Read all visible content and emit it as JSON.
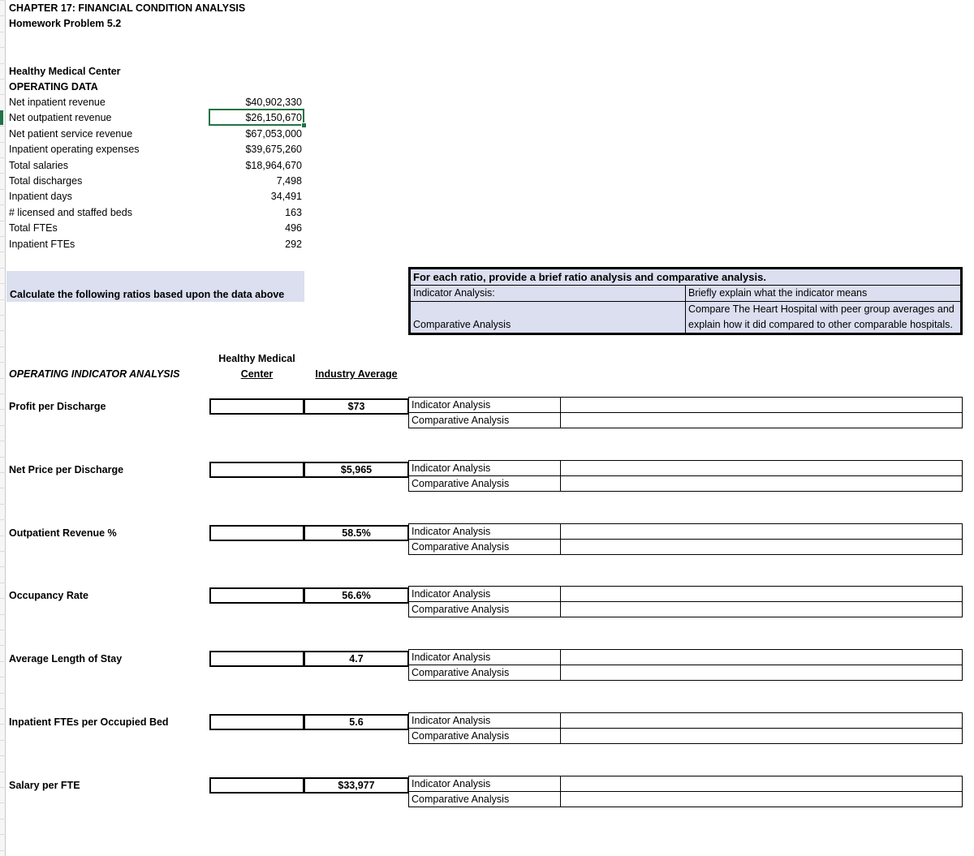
{
  "document": {
    "chapter_title": "CHAPTER 17: FINANCIAL CONDITION ANALYSIS",
    "homework_title": "Homework Problem 5.2",
    "entity_name": "Healthy  Medical Center",
    "section_title": "OPERATING DATA"
  },
  "operating_data": [
    {
      "label": "Net inpatient revenue",
      "value": "$40,902,330"
    },
    {
      "label": "Net outpatient revenue",
      "value": "$26,150,670"
    },
    {
      "label": "Net patient service revenue",
      "value": "$67,053,000"
    },
    {
      "label": "Inpatient operating expenses",
      "value": "$39,675,260"
    },
    {
      "label": "Total salaries",
      "value": "$18,964,670"
    },
    {
      "label": "Total discharges",
      "value": "7,498"
    },
    {
      "label": "Inpatient days",
      "value": "34,491"
    },
    {
      "label": "# licensed and staffed beds",
      "value": "163"
    },
    {
      "label": "Total FTEs",
      "value": "496"
    },
    {
      "label": "Inpatient FTEs",
      "value": "292"
    }
  ],
  "selection": {
    "selected_cell_value": "$26,150,670",
    "selected_row_label": "Net outpatient revenue",
    "accent_color": "#217346"
  },
  "calc_note": {
    "text": "Calculate the following ratios based upon the data above",
    "fill_color": "#dbdfef"
  },
  "instruction_table": {
    "header": "For each ratio, provide a brief ratio analysis and comparative analysis.",
    "rows": [
      {
        "key": "Indicator Analysis:",
        "value": "Briefly explain what the indicator means"
      },
      {
        "key": "Comparative Analysis",
        "value": "Compare The Heart Hospital with peer group averages and explain how it did compared to other comparable hospitals."
      }
    ]
  },
  "analysis_table": {
    "title": "OPERATING INDICATOR ANALYSIS",
    "col_hmc_line1": "Healthy  Medical",
    "col_hmc_line2": "Center",
    "col_industry": "Industry Average",
    "row_labels": {
      "indicator": "Indicator Analysis",
      "comparative": "Comparative Analysis"
    },
    "rows": [
      {
        "label": "Profit per Discharge",
        "hmc": "",
        "industry": "$73"
      },
      {
        "label": "Net Price per Discharge",
        "hmc": "",
        "industry": "$5,965"
      },
      {
        "label": "Outpatient Revenue %",
        "hmc": "",
        "industry": "58.5%"
      },
      {
        "label": "Occupancy Rate",
        "hmc": "",
        "industry": "56.6%"
      },
      {
        "label": "Average Length of Stay",
        "hmc": "",
        "industry": "4.7"
      },
      {
        "label": "Inpatient FTEs per Occupied Bed",
        "hmc": "",
        "industry": "5.6"
      },
      {
        "label": "Salary per FTE",
        "hmc": "",
        "industry": "$33,977"
      }
    ]
  }
}
